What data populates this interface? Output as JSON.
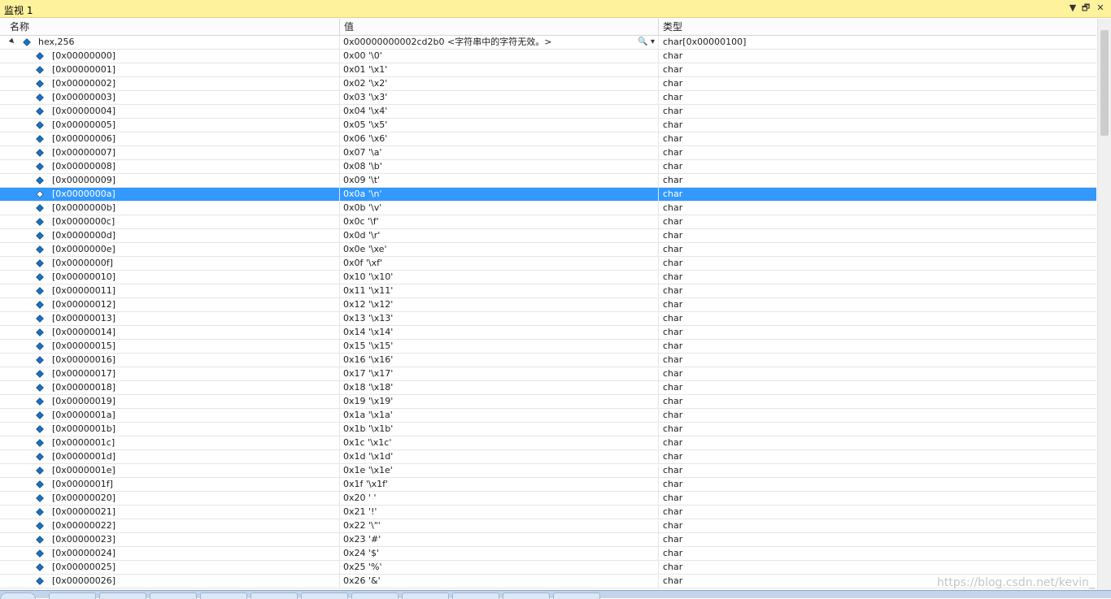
{
  "window": {
    "title": "监视 1",
    "btn_dropdown": "▼",
    "btn_restore": "🗗",
    "btn_close": "✕"
  },
  "columns": {
    "name": "名称",
    "value": "值",
    "type": "类型"
  },
  "root": {
    "name": "hex,256",
    "value": "0x00000000002cd2b0  <字符串中的字符无效。>",
    "type": "char[0x00000100]",
    "search_icon": "🔍 ▾"
  },
  "selected_index": 10,
  "rows": [
    {
      "name": "[0x00000000]",
      "value": "0x00 '\\0'",
      "type": "char"
    },
    {
      "name": "[0x00000001]",
      "value": "0x01 '\\x1'",
      "type": "char"
    },
    {
      "name": "[0x00000002]",
      "value": "0x02 '\\x2'",
      "type": "char"
    },
    {
      "name": "[0x00000003]",
      "value": "0x03 '\\x3'",
      "type": "char"
    },
    {
      "name": "[0x00000004]",
      "value": "0x04 '\\x4'",
      "type": "char"
    },
    {
      "name": "[0x00000005]",
      "value": "0x05 '\\x5'",
      "type": "char"
    },
    {
      "name": "[0x00000006]",
      "value": "0x06 '\\x6'",
      "type": "char"
    },
    {
      "name": "[0x00000007]",
      "value": "0x07 '\\a'",
      "type": "char"
    },
    {
      "name": "[0x00000008]",
      "value": "0x08 '\\b'",
      "type": "char"
    },
    {
      "name": "[0x00000009]",
      "value": "0x09 '\\t'",
      "type": "char"
    },
    {
      "name": "[0x0000000a]",
      "value": "0x0a '\\n'",
      "type": "char"
    },
    {
      "name": "[0x0000000b]",
      "value": "0x0b '\\v'",
      "type": "char"
    },
    {
      "name": "[0x0000000c]",
      "value": "0x0c '\\f'",
      "type": "char"
    },
    {
      "name": "[0x0000000d]",
      "value": "0x0d '\\r'",
      "type": "char"
    },
    {
      "name": "[0x0000000e]",
      "value": "0x0e '\\xe'",
      "type": "char"
    },
    {
      "name": "[0x0000000f]",
      "value": "0x0f '\\xf'",
      "type": "char"
    },
    {
      "name": "[0x00000010]",
      "value": "0x10 '\\x10'",
      "type": "char"
    },
    {
      "name": "[0x00000011]",
      "value": "0x11 '\\x11'",
      "type": "char"
    },
    {
      "name": "[0x00000012]",
      "value": "0x12 '\\x12'",
      "type": "char"
    },
    {
      "name": "[0x00000013]",
      "value": "0x13 '\\x13'",
      "type": "char"
    },
    {
      "name": "[0x00000014]",
      "value": "0x14 '\\x14'",
      "type": "char"
    },
    {
      "name": "[0x00000015]",
      "value": "0x15 '\\x15'",
      "type": "char"
    },
    {
      "name": "[0x00000016]",
      "value": "0x16 '\\x16'",
      "type": "char"
    },
    {
      "name": "[0x00000017]",
      "value": "0x17 '\\x17'",
      "type": "char"
    },
    {
      "name": "[0x00000018]",
      "value": "0x18 '\\x18'",
      "type": "char"
    },
    {
      "name": "[0x00000019]",
      "value": "0x19 '\\x19'",
      "type": "char"
    },
    {
      "name": "[0x0000001a]",
      "value": "0x1a '\\x1a'",
      "type": "char"
    },
    {
      "name": "[0x0000001b]",
      "value": "0x1b '\\x1b'",
      "type": "char"
    },
    {
      "name": "[0x0000001c]",
      "value": "0x1c '\\x1c'",
      "type": "char"
    },
    {
      "name": "[0x0000001d]",
      "value": "0x1d '\\x1d'",
      "type": "char"
    },
    {
      "name": "[0x0000001e]",
      "value": "0x1e '\\x1e'",
      "type": "char"
    },
    {
      "name": "[0x0000001f]",
      "value": "0x1f '\\x1f'",
      "type": "char"
    },
    {
      "name": "[0x00000020]",
      "value": "0x20 ' '",
      "type": "char"
    },
    {
      "name": "[0x00000021]",
      "value": "0x21 '!'",
      "type": "char"
    },
    {
      "name": "[0x00000022]",
      "value": "0x22 '\\\"'",
      "type": "char"
    },
    {
      "name": "[0x00000023]",
      "value": "0x23 '#'",
      "type": "char"
    },
    {
      "name": "[0x00000024]",
      "value": "0x24 '$'",
      "type": "char"
    },
    {
      "name": "[0x00000025]",
      "value": "0x25 '%'",
      "type": "char"
    },
    {
      "name": "[0x00000026]",
      "value": "0x26 '&'",
      "type": "char"
    }
  ],
  "watermark": "https://blog.csdn.net/kevin_"
}
